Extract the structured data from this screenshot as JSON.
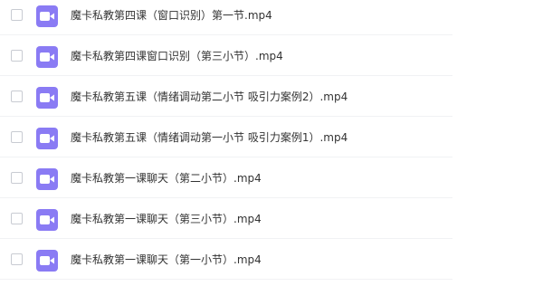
{
  "files": [
    {
      "name": "魔卡私教第四课（窗口识别）第一节.mp4",
      "icon": "video-file-icon"
    },
    {
      "name": "魔卡私教第四课窗口识别（第三小节）.mp4",
      "icon": "video-file-icon"
    },
    {
      "name": "魔卡私教第五课（情绪调动第二小节 吸引力案例2）.mp4",
      "icon": "video-file-icon"
    },
    {
      "name": "魔卡私教第五课（情绪调动第一小节 吸引力案例1）.mp4",
      "icon": "video-file-icon"
    },
    {
      "name": "魔卡私教第一课聊天（第二小节）.mp4",
      "icon": "video-file-icon"
    },
    {
      "name": "魔卡私教第一课聊天（第三小节）.mp4",
      "icon": "video-file-icon"
    },
    {
      "name": "魔卡私教第一课聊天（第一小节）.mp4",
      "icon": "video-file-icon"
    }
  ],
  "colors": {
    "icon_bg": "#8a7bf4",
    "text": "#333333",
    "divider": "#f1f2f4"
  }
}
